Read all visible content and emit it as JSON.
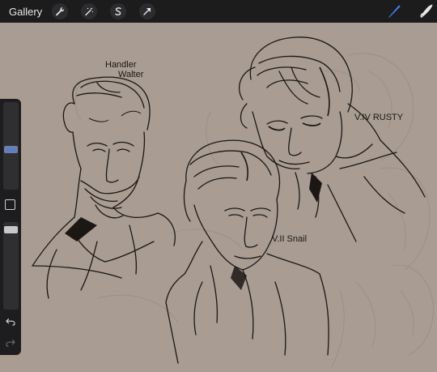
{
  "topbar": {
    "gallery_label": "Gallery",
    "tools": [
      {
        "icon": "wrench-icon"
      },
      {
        "icon": "magic-wand-icon"
      },
      {
        "icon": "selection-s-icon"
      },
      {
        "icon": "transform-arrow-icon"
      }
    ],
    "right_tools": [
      {
        "icon": "brush-icon",
        "active": true
      },
      {
        "icon": "smudge-icon"
      }
    ]
  },
  "sidebar": {
    "brush_size_level": 0.45,
    "opacity_level": 0.95,
    "modify_button_icon": "square-icon",
    "undo_icon": "undo-icon",
    "redo_icon": "redo-icon"
  },
  "canvas": {
    "labels": {
      "handler": "Handler",
      "walter": "Walter",
      "rusty": "V.IV RUSTY",
      "snail": "V.II Snail"
    }
  },
  "colors": {
    "canvas_bg": "#a99c92",
    "topbar_bg": "#1c1c1d",
    "accent_blue": "#3b82f6",
    "ink": "#1b1714"
  }
}
